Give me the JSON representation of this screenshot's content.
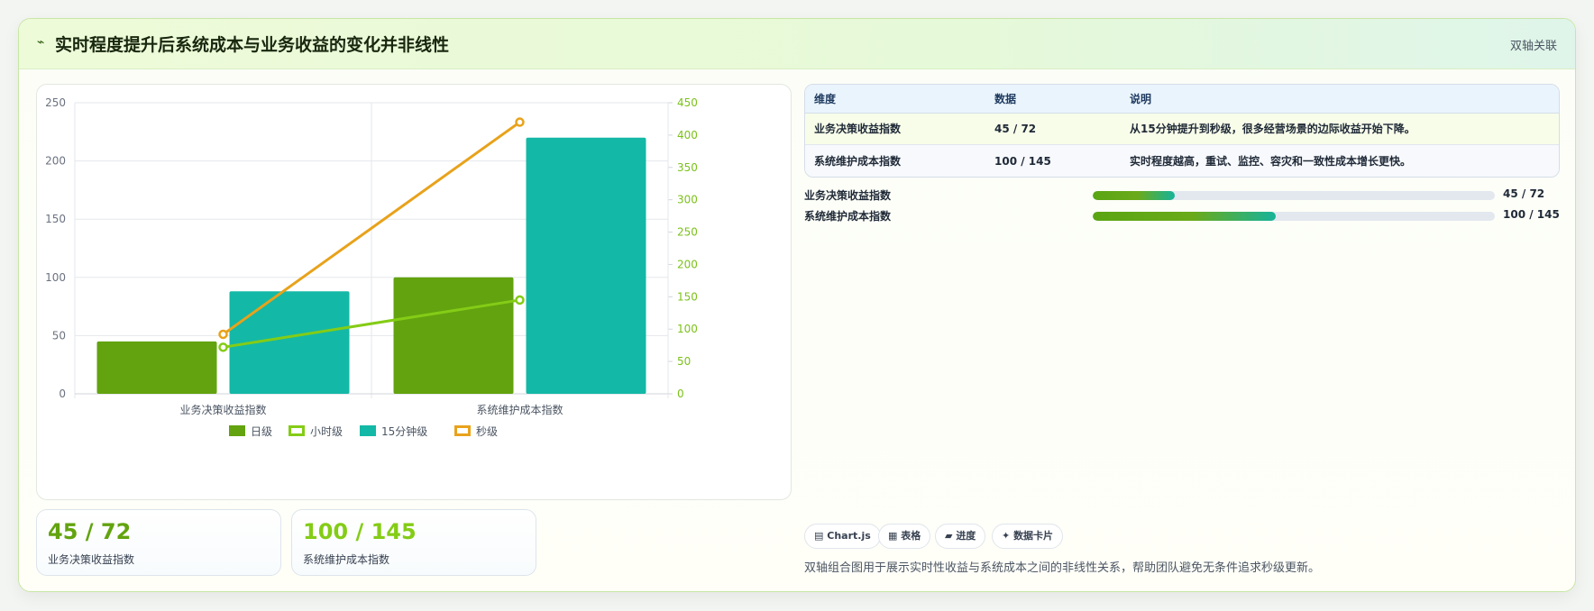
{
  "header": {
    "icon": "lightning-icon",
    "icon_glyph": "⌁",
    "title": "实时程度提升后系统成本与业务收益的变化并非线性",
    "tag": "双轴关联"
  },
  "chart_data": {
    "type": "bar",
    "categories": [
      "业务决策收益指数",
      "系统维护成本指数"
    ],
    "series": [
      {
        "name": "日级",
        "kind": "bar",
        "axis": "left",
        "color": "#62a30f",
        "values": [
          45,
          100
        ]
      },
      {
        "name": "15分钟级",
        "kind": "bar",
        "axis": "left",
        "color": "#14b8a6",
        "values": [
          88,
          220
        ]
      },
      {
        "name": "小时级",
        "kind": "line",
        "axis": "right",
        "color": "#84cc16",
        "values": [
          72,
          145
        ]
      },
      {
        "name": "秒级",
        "kind": "line",
        "axis": "right",
        "color": "#e8a21a",
        "values": [
          92,
          420
        ]
      }
    ],
    "legend_order": [
      "日级",
      "小时级",
      "15分钟级",
      "秒级"
    ],
    "legend_placement": "bottom-center",
    "y_left": {
      "min": 0,
      "max": 250,
      "ticks": [
        "0",
        "50",
        "100",
        "150",
        "200",
        "250"
      ]
    },
    "y_right": {
      "min": 0,
      "max": 450,
      "ticks": [
        "0",
        "50",
        "100",
        "150",
        "200",
        "250",
        "300",
        "350",
        "400",
        "450"
      ],
      "color": "#7cc11a"
    },
    "grid": true
  },
  "table": {
    "headers": [
      "维度",
      "数据",
      "说明"
    ],
    "rows": [
      [
        "业务决策收益指数",
        "45 / 72",
        "从15分钟提升到秒级，很多经营场景的边际收益开始下降。"
      ],
      [
        "系统维护成本指数",
        "100 / 145",
        "实时程度越高，重试、监控、容灾和一致性成本增长更快。"
      ]
    ]
  },
  "progress": [
    {
      "label": "业务决策收益指数",
      "value": "45 / 72",
      "fraction": 0.204
    },
    {
      "label": "系统维护成本指数",
      "value": "100 / 145",
      "fraction": 0.455
    }
  ],
  "kpis": [
    {
      "value": "45 / 72",
      "label": "业务决策收益指数",
      "color": "#62a30f"
    },
    {
      "value": "100 / 145",
      "label": "系统维护成本指数",
      "color": "#84cc16"
    }
  ],
  "tags": [
    {
      "icon": "chart-icon",
      "glyph": "▤",
      "label": "Chart.js"
    },
    {
      "icon": "table-icon",
      "glyph": "▦",
      "label": "表格"
    },
    {
      "icon": "progress-icon",
      "glyph": "▰",
      "label": "进度"
    },
    {
      "icon": "sparkle-icon",
      "glyph": "✦",
      "label": "数据卡片"
    }
  ],
  "note": "双轴组合图用于展示实时性收益与系统成本之间的非线性关系，帮助团队避免无条件追求秒级更新。"
}
